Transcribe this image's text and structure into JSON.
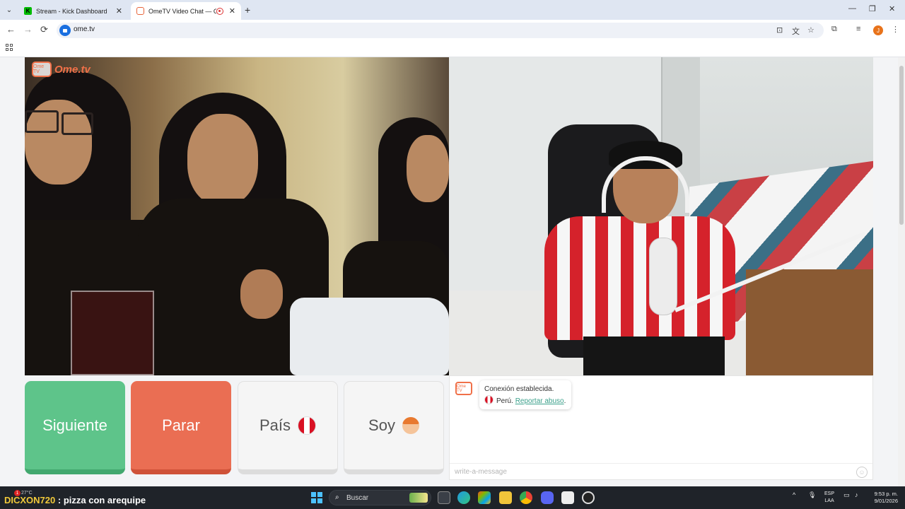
{
  "browser": {
    "tabs": [
      {
        "title": "Stream - Kick Dashboard",
        "favicon": "kick-icon",
        "active": false
      },
      {
        "title": "OmeTV Video Chat — Ome",
        "favicon": "ometv-icon",
        "active": true
      }
    ],
    "new_tab": "+",
    "window_controls": {
      "minimize": "—",
      "maximize": "❐",
      "close": "✕"
    },
    "address": {
      "url": "ome.tv"
    },
    "nav": {
      "back": "←",
      "forward": "→",
      "reload": "⟳"
    },
    "profile_initial": "J"
  },
  "page": {
    "logo_text": "Ome.tv",
    "logo_icon_text": "Ome TV",
    "controls": {
      "next_label": "Siguiente",
      "stop_label": "Parar",
      "country_label": "País",
      "gender_label": "Soy"
    },
    "chat": {
      "avatar_text": "Ome TV",
      "status_message": "Conexión establecida.",
      "country": "Perú.",
      "report_link": "Reportar abuso",
      "report_suffix": ".",
      "input_placeholder": "write-a-message",
      "emoji_icon": "☺"
    }
  },
  "taskbar": {
    "overlay_user": "DICXON720",
    "overlay_message": ": pizza con arequipe",
    "weather": "27°C",
    "badge_count": "1",
    "search_label": "Buscar",
    "language": "ESP",
    "keyboard_layout": "LAA",
    "time": "9:53 p. m.",
    "date": "9/01/2026"
  },
  "colors": {
    "next": "#5ec48a",
    "stop": "#ea6e53",
    "accent": "#f07048",
    "link": "#3ba08b"
  }
}
